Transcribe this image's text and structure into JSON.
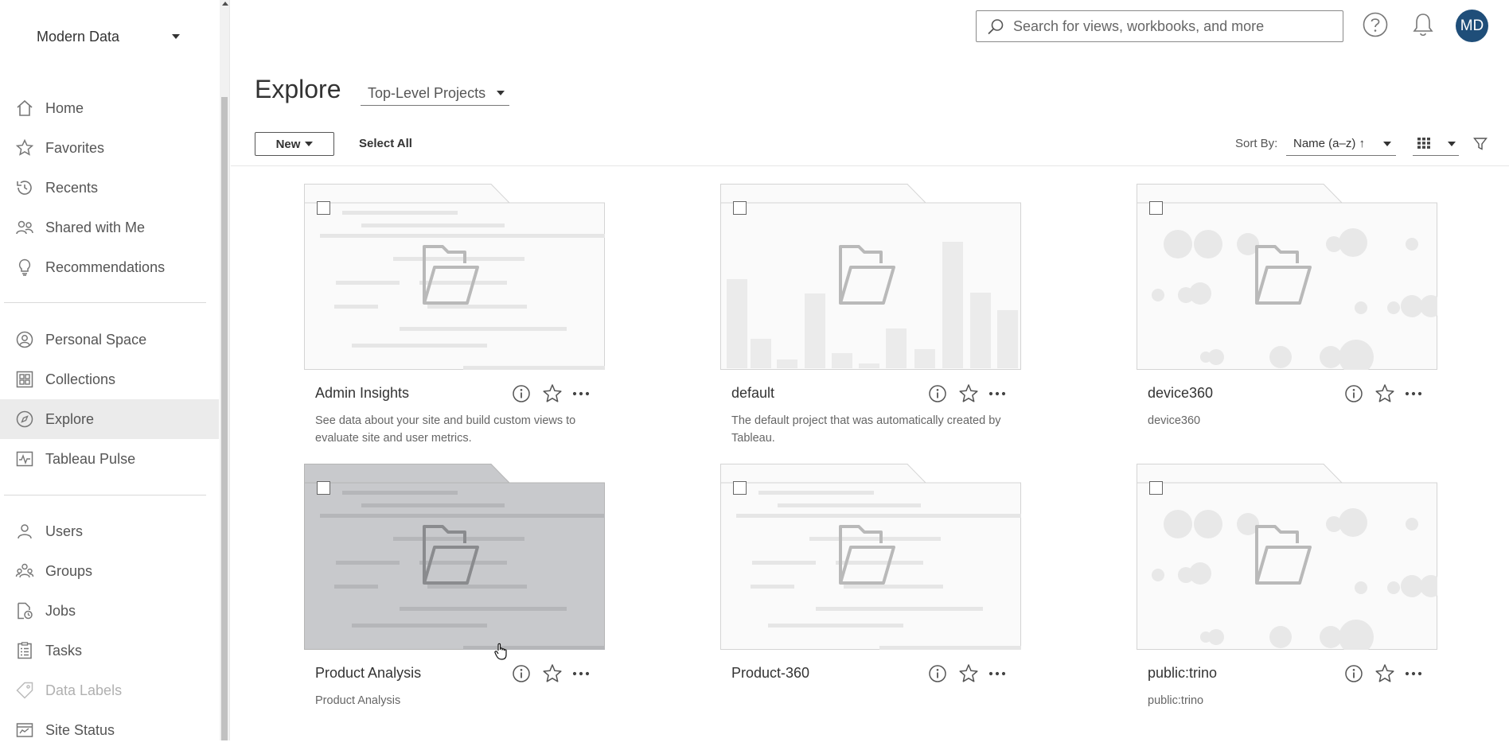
{
  "sidebar": {
    "site_name": "Modern Data",
    "items": [
      {
        "id": "home",
        "label": "Home",
        "icon": "home-icon"
      },
      {
        "id": "favorites",
        "label": "Favorites",
        "icon": "star-icon"
      },
      {
        "id": "recents",
        "label": "Recents",
        "icon": "history-icon"
      },
      {
        "id": "shared",
        "label": "Shared with Me",
        "icon": "shared-users-icon"
      },
      {
        "id": "recommendations",
        "label": "Recommendations",
        "icon": "lightbulb-icon"
      },
      {
        "id": "personal-space",
        "label": "Personal Space",
        "icon": "person-circle-icon"
      },
      {
        "id": "collections",
        "label": "Collections",
        "icon": "collections-icon"
      },
      {
        "id": "explore",
        "label": "Explore",
        "icon": "compass-icon",
        "active": true
      },
      {
        "id": "tableau-pulse",
        "label": "Tableau Pulse",
        "icon": "pulse-icon"
      },
      {
        "id": "users",
        "label": "Users",
        "icon": "user-icon"
      },
      {
        "id": "groups",
        "label": "Groups",
        "icon": "group-icon"
      },
      {
        "id": "jobs",
        "label": "Jobs",
        "icon": "jobs-icon"
      },
      {
        "id": "tasks",
        "label": "Tasks",
        "icon": "clipboard-icon"
      },
      {
        "id": "data-labels",
        "label": "Data Labels",
        "icon": "tag-icon",
        "disabled": true
      },
      {
        "id": "site-status",
        "label": "Site Status",
        "icon": "status-icon"
      }
    ]
  },
  "header": {
    "search_placeholder": "Search for views, workbooks, and more",
    "avatar_initials": "MD"
  },
  "page": {
    "title": "Explore",
    "scope": "Top-Level Projects"
  },
  "toolbar": {
    "new_label": "New",
    "select_all_label": "Select All",
    "sort_label": "Sort By:",
    "sort_value": "Name (a–z) ↑"
  },
  "cards": [
    {
      "title": "Admin Insights",
      "description": "See data about your site and build custom views to evaluate site and user metrics.",
      "thumbnail": "text-lines",
      "highlighted": false
    },
    {
      "title": "default",
      "description": "The default project that was automatically created by Tableau.",
      "thumbnail": "bars",
      "highlighted": false
    },
    {
      "title": "device360",
      "description": "device360",
      "thumbnail": "bubbles",
      "highlighted": false
    },
    {
      "title": "Product Analysis",
      "description": "Product Analysis",
      "thumbnail": "text-lines",
      "highlighted": true
    },
    {
      "title": "Product-360",
      "description": "",
      "thumbnail": "text-lines",
      "highlighted": false
    },
    {
      "title": "public:trino",
      "description": "public:trino",
      "thumbnail": "bubbles",
      "highlighted": false
    }
  ],
  "colors": {
    "avatar_bg": "#1f4e79",
    "active_nav_bg": "#ebebeb",
    "highlight_thumb": "#c8c9cc"
  }
}
